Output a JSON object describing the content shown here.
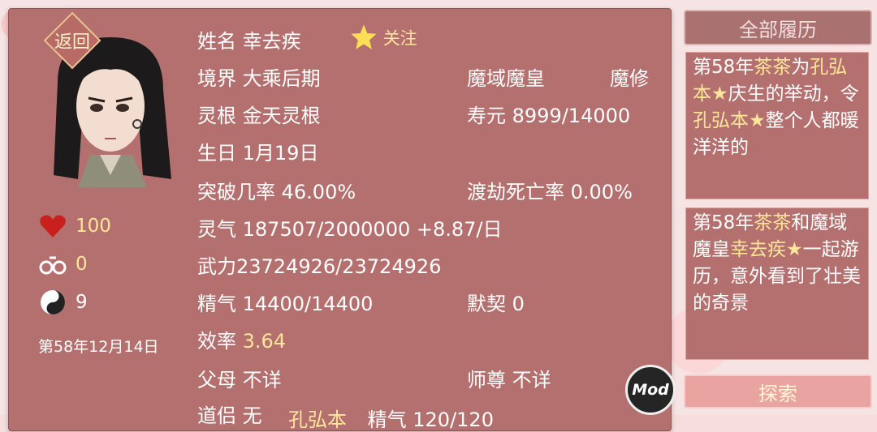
{
  "back_label": "返回",
  "follow_label": "关注",
  "profile": {
    "name_label": "姓名",
    "name": "幸去疾",
    "realm_label": "境界",
    "realm": "大乘后期",
    "title": "魔域魔皇",
    "path": "魔修",
    "root_label": "灵根",
    "root": "金天灵根",
    "lifespan_label": "寿元",
    "lifespan": "8999/14000",
    "birthday_label": "生日",
    "birthday": "1月19日",
    "breakthrough_label": "突破几率",
    "breakthrough": "46.00%",
    "tribulation_label": "渡劫死亡率",
    "tribulation": "0.00%",
    "qi_label": "灵气",
    "qi": "187507/2000000 +8.87/日",
    "force_label": "武力",
    "force": "23724926/23724926",
    "essence_label": "精气",
    "essence": "14400/14400",
    "tacit_label": "默契",
    "tacit": "0",
    "efficiency_label": "效率",
    "efficiency": "3.64",
    "parents_label": "父母",
    "parents": "不详",
    "master_label": "师尊",
    "master": "不详",
    "partial_row_label": "道侣",
    "partial_row_value": "无",
    "partial_row2_name": "孔弘本",
    "partial_row2_text": "精气 120/120"
  },
  "stats": {
    "health": "100",
    "shackles": "0",
    "taiji": "9"
  },
  "game_date": "第58年12月14日",
  "history_label": "全部履历",
  "explore_label": "探索",
  "mod_label": "Mod",
  "events": [
    {
      "prefix": "第58年",
      "a": "茶茶",
      "mid": "为",
      "b": "孔弘本★",
      "suffix": "庆生的举动，令",
      "c": "孔弘本★",
      "end": "整个人都暖洋洋的"
    },
    {
      "prefix": "第58年",
      "a": "茶茶",
      "mid": "和魔域魔皇",
      "b": "幸去疾★",
      "suffix": "一起游历，意外看到了壮美的奇景"
    }
  ],
  "colors": {
    "panel": "#b3706e",
    "highlight": "#ffe69a",
    "accent_red": "#c9201e"
  }
}
